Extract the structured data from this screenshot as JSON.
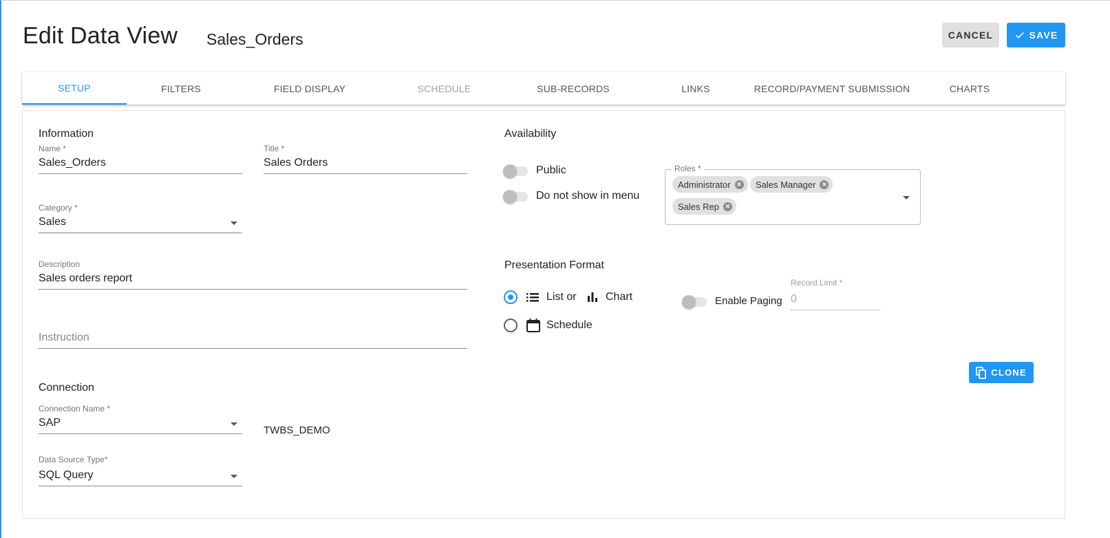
{
  "header": {
    "title": "Edit Data View",
    "view_name": "Sales_Orders",
    "cancel_label": "CANCEL",
    "save_label": "SAVE",
    "save_icon": "check-icon"
  },
  "tabs": [
    {
      "label": "SETUP",
      "state": "active"
    },
    {
      "label": "FILTERS",
      "state": "normal"
    },
    {
      "label": "FIELD DISPLAY",
      "state": "normal"
    },
    {
      "label": "SCHEDULE",
      "state": "disabled"
    },
    {
      "label": "SUB-RECORDS",
      "state": "normal"
    },
    {
      "label": "LINKS",
      "state": "normal"
    },
    {
      "label": "RECORD/PAYMENT SUBMISSION",
      "state": "normal"
    },
    {
      "label": "CHARTS",
      "state": "normal"
    }
  ],
  "information": {
    "heading": "Information",
    "name_label": "Name *",
    "name_value": "Sales_Orders",
    "title_label": "Title *",
    "title_value": "Sales Orders",
    "category_label": "Category *",
    "category_value": "Sales",
    "description_label": "Description",
    "description_value": "Sales orders report",
    "instruction_placeholder": "Instruction"
  },
  "connection": {
    "heading": "Connection",
    "connection_name_label": "Connection Name *",
    "connection_name_value": "SAP",
    "connection_db": "TWBS_DEMO",
    "data_source_type_label": "Data Source Type*",
    "data_source_type_value": "SQL Query"
  },
  "availability": {
    "heading": "Availability",
    "public_label": "Public",
    "public_on": false,
    "hide_menu_label": "Do not show in menu",
    "hide_menu_on": false,
    "roles_label": "Roles *",
    "roles": [
      "Administrator",
      "Sales Manager",
      "Sales Rep"
    ]
  },
  "presentation": {
    "heading": "Presentation Format",
    "option_list_label": "List or",
    "option_chart_label": "Chart",
    "option_schedule_label": "Schedule",
    "selected": "list_or_chart",
    "enable_paging_label": "Enable Paging",
    "enable_paging_on": false,
    "record_limit_label": "Record Limit *",
    "record_limit_value": "0"
  },
  "actions": {
    "clone_label": "CLONE",
    "clone_icon": "copy-icon"
  },
  "colors": {
    "accent": "#2196f3",
    "cancel_bg": "#e0e0e0",
    "disabled_text": "#a0a0a0"
  }
}
